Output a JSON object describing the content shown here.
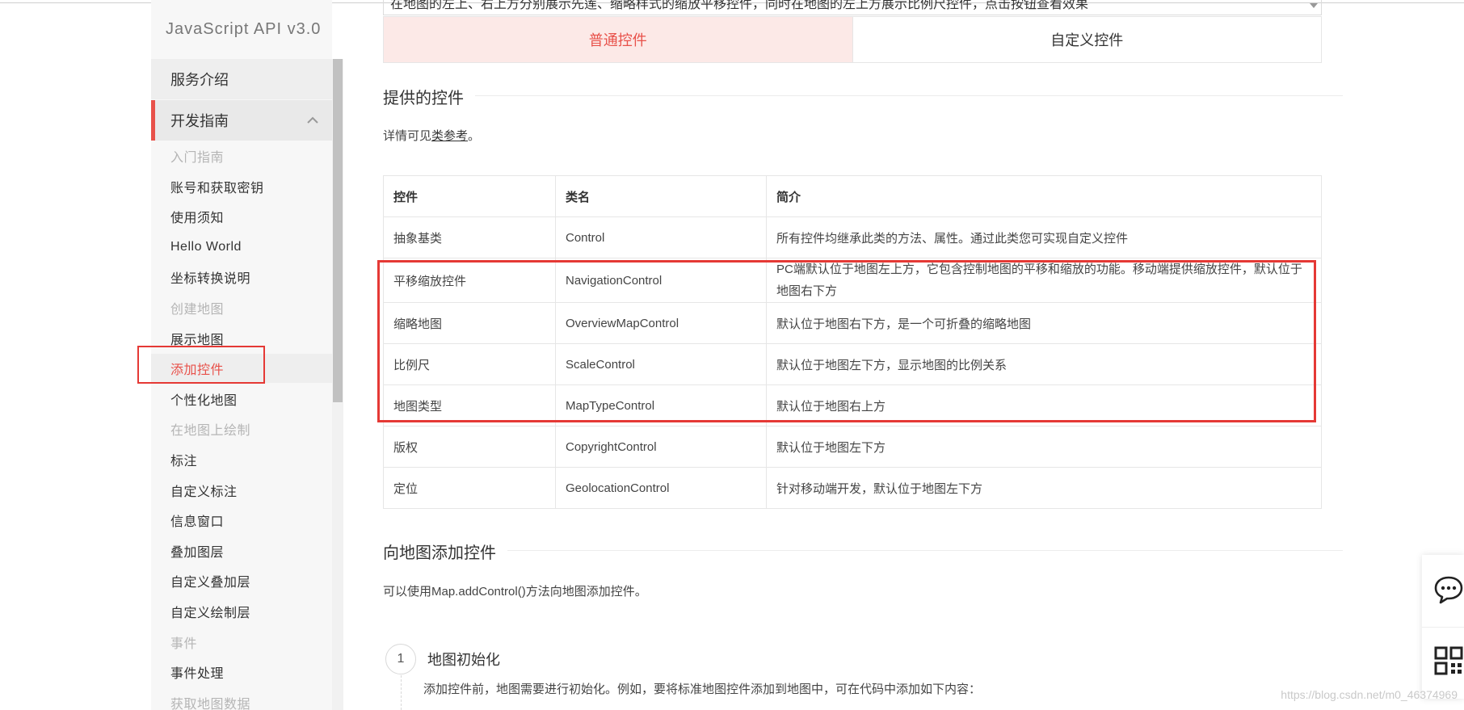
{
  "sidebar": {
    "title": "JavaScript API v3.0",
    "sections": {
      "intro": "服务介绍",
      "dev_guide": "开发指南"
    },
    "items": [
      {
        "label": "入门指南",
        "state": "muted"
      },
      {
        "label": "账号和获取密钥",
        "state": "normal"
      },
      {
        "label": "使用须知",
        "state": "normal"
      },
      {
        "label": "Hello World",
        "state": "normal"
      },
      {
        "label": "坐标转换说明",
        "state": "normal"
      },
      {
        "label": "创建地图",
        "state": "muted"
      },
      {
        "label": "展示地图",
        "state": "normal"
      },
      {
        "label": "添加控件",
        "state": "active"
      },
      {
        "label": "个性化地图",
        "state": "normal"
      },
      {
        "label": "在地图上绘制",
        "state": "muted"
      },
      {
        "label": "标注",
        "state": "normal"
      },
      {
        "label": "自定义标注",
        "state": "normal"
      },
      {
        "label": "信息窗口",
        "state": "normal"
      },
      {
        "label": "叠加图层",
        "state": "normal"
      },
      {
        "label": "自定义叠加层",
        "state": "normal"
      },
      {
        "label": "自定义绘制层",
        "state": "normal"
      },
      {
        "label": "事件",
        "state": "muted"
      },
      {
        "label": "事件处理",
        "state": "normal"
      },
      {
        "label": "获取地图数据",
        "state": "muted"
      }
    ]
  },
  "top_description": "在地图的左上、右上方分别展示先莲、缩略样式的缩放平移控件，同时在地图的左上方展示比例尺控件，点击按钮查看效果",
  "tabs": {
    "standard": "普通控件",
    "custom": "自定义控件"
  },
  "section_provided": {
    "title": "提供的控件",
    "para_prefix": "详情可见",
    "link": "类参考",
    "para_suffix": "。"
  },
  "controls_table": {
    "headers": [
      "控件",
      "类名",
      "简介"
    ],
    "rows": [
      [
        "抽象基类",
        "Control",
        "所有控件均继承此类的方法、属性。通过此类您可实现自定义控件"
      ],
      [
        "平移缩放控件",
        "NavigationControl",
        "PC端默认位于地图左上方，它包含控制地图的平移和缩放的功能。移动端提供缩放控件，默认位于地图右下方"
      ],
      [
        "缩略地图",
        "OverviewMapControl",
        "默认位于地图右下方，是一个可折叠的缩略地图"
      ],
      [
        "比例尺",
        "ScaleControl",
        "默认位于地图左下方，显示地图的比例关系"
      ],
      [
        "地图类型",
        "MapTypeControl",
        "默认位于地图右上方"
      ],
      [
        "版权",
        "CopyrightControl",
        "默认位于地图左下方"
      ],
      [
        "定位",
        "GeolocationControl",
        "针对移动端开发，默认位于地图左下方"
      ]
    ]
  },
  "section_add": {
    "title": "向地图添加控件",
    "para": "可以使用Map.addControl()方法向地图添加控件。"
  },
  "step": {
    "number": "1",
    "title": "地图初始化",
    "text": "添加控件前，地图需要进行初始化。例如，要将标准地图控件添加到地图中，可在代码中添加如下内容："
  },
  "watermark": "https://blog.csdn.net/m0_46374969",
  "icons": {
    "chevron": "chevron-up-icon",
    "chat": "chat-icon",
    "qrcode": "qrcode-icon"
  },
  "colors": {
    "accent": "#e8514a",
    "highlight_box": "#e53935",
    "tab_active_bg": "#fce9e7"
  }
}
